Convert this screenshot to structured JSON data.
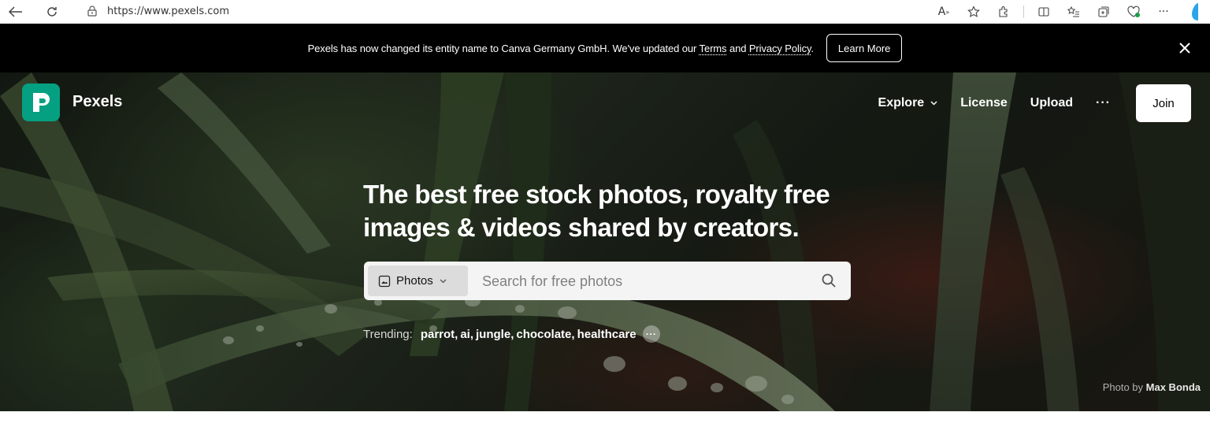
{
  "browser": {
    "url": "https://www.pexels.com"
  },
  "announcement": {
    "text_before": "Pexels has now changed its entity name to Canva Germany GmbH. We've updated our ",
    "terms_link": "Terms",
    "text_and": " and ",
    "privacy_link": "Privacy Policy",
    "text_after": ".",
    "learn_more_label": "Learn More"
  },
  "header": {
    "logo_text": "Pexels",
    "nav": {
      "explore": "Explore",
      "license": "License",
      "upload": "Upload",
      "more": "···",
      "join": "Join"
    }
  },
  "hero": {
    "headline_line1": "The best free stock photos, royalty free",
    "headline_line2": "images & videos shared by creators.",
    "search": {
      "type_label": "Photos",
      "placeholder": "Search for free photos"
    },
    "trending": {
      "label": "Trending:",
      "tags": [
        "parrot",
        "ai",
        "jungle",
        "chocolate",
        "healthcare"
      ]
    },
    "credit_prefix": "Photo by ",
    "credit_author": "Max Bonda"
  },
  "colors": {
    "brand": "#05a081",
    "announcement_bg": "#000000"
  }
}
